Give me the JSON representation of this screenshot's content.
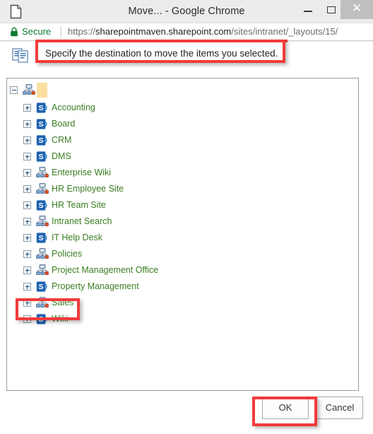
{
  "window": {
    "title": "Move... - Google Chrome",
    "page_icon": "page-icon",
    "minimize_label": "–",
    "maximize_label": "□",
    "close_label": "✕"
  },
  "address_bar": {
    "lock_icon": "lock-icon",
    "secure_label": "Secure",
    "url_scheme": "https://",
    "url_domain": "sharepointmaven.sharepoint.com",
    "url_path": "/sites/intranet/_layouts/15/"
  },
  "instruction": {
    "icon": "copy-move-documents-icon",
    "text": "Specify the destination to move the items you selected."
  },
  "tree": {
    "root": {
      "expander": "minus",
      "icon": "network-site-icon",
      "label": "",
      "selected": true
    },
    "items": [
      {
        "label": "Accounting",
        "icon": "sharepoint-site-icon",
        "expander": "plus"
      },
      {
        "label": "Board",
        "icon": "sharepoint-site-icon",
        "expander": "plus"
      },
      {
        "label": "CRM",
        "icon": "sharepoint-site-icon",
        "expander": "plus"
      },
      {
        "label": "DMS",
        "icon": "sharepoint-site-icon",
        "expander": "plus"
      },
      {
        "label": "Enterprise Wiki",
        "icon": "network-site-icon",
        "expander": "plus"
      },
      {
        "label": "HR Employee Site",
        "icon": "network-site-icon",
        "expander": "plus"
      },
      {
        "label": "HR Team Site",
        "icon": "sharepoint-site-icon",
        "expander": "plus"
      },
      {
        "label": "Intranet Search",
        "icon": "network-site-icon",
        "expander": "plus"
      },
      {
        "label": "IT Help Desk",
        "icon": "sharepoint-site-icon",
        "expander": "plus"
      },
      {
        "label": "Policies",
        "icon": "network-site-icon",
        "expander": "plus"
      },
      {
        "label": "Project Management Office",
        "icon": "network-site-icon",
        "expander": "plus"
      },
      {
        "label": "Property Management",
        "icon": "sharepoint-site-icon",
        "expander": "plus"
      },
      {
        "label": "Sales",
        "icon": "network-site-icon",
        "expander": "plus"
      },
      {
        "label": "Wiki",
        "icon": "sharepoint-site-icon",
        "expander": "plus"
      }
    ]
  },
  "footer": {
    "ok_label": "OK",
    "cancel_label": "Cancel"
  },
  "annotations": {
    "accent_color": "#f23a3a",
    "highlighted": [
      "instruction-text",
      "tree-item-sales",
      "ok-button"
    ]
  },
  "colors": {
    "link_green": "#3a7d22",
    "secure_green": "#0a7c2f",
    "sharepoint_blue": "#1e63b0",
    "selection_amber": "#fbdfa0"
  }
}
